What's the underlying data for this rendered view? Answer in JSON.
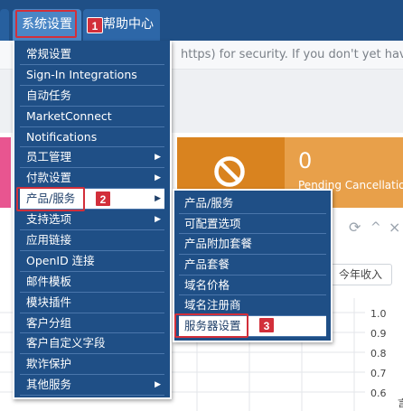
{
  "topnav": {
    "tabs": [
      {
        "label": "系统设置"
      },
      {
        "label": "帮助中心"
      }
    ]
  },
  "background": {
    "notice_text": "https) for security. If you don't yet have an",
    "pending_count": "0",
    "pending_label": "Pending Cancellation",
    "year_button": "今年收入",
    "y_ticks": [
      "1.0",
      "0.9",
      "0.8",
      "0.7",
      "0.6"
    ],
    "side_char": "言"
  },
  "menu": {
    "items": [
      {
        "label": "常规设置",
        "has_arrow": false
      },
      {
        "label": "Sign-In Integrations",
        "has_arrow": false
      },
      {
        "label": "自动任务",
        "has_arrow": false
      },
      {
        "label": "MarketConnect",
        "has_arrow": false
      },
      {
        "label": "Notifications",
        "has_arrow": false
      },
      {
        "label": "员工管理",
        "has_arrow": true
      },
      {
        "label": "付款设置",
        "has_arrow": true
      },
      {
        "label": "产品/服务",
        "has_arrow": true,
        "active": true
      },
      {
        "label": "支持选项",
        "has_arrow": true
      },
      {
        "label": "应用链接",
        "has_arrow": false
      },
      {
        "label": "OpenID 连接",
        "has_arrow": false
      },
      {
        "label": "邮件模板",
        "has_arrow": false
      },
      {
        "label": "模块插件",
        "has_arrow": false
      },
      {
        "label": "客户分组",
        "has_arrow": false
      },
      {
        "label": "客户自定义字段",
        "has_arrow": false
      },
      {
        "label": "欺诈保护",
        "has_arrow": false
      },
      {
        "label": "其他服务",
        "has_arrow": true
      }
    ]
  },
  "submenu": {
    "items": [
      {
        "label": "产品/服务"
      },
      {
        "label": "可配置选项"
      },
      {
        "label": "产品附加套餐"
      },
      {
        "label": "产品套餐"
      },
      {
        "label": "域名价格"
      },
      {
        "label": "域名注册商"
      },
      {
        "label": "服务器设置",
        "active": true
      }
    ]
  },
  "callouts": {
    "step1": "1",
    "step2": "2",
    "step3": "3"
  },
  "colors": {
    "nav_bg": "#1f4f86",
    "callout_red": "#d22f3a",
    "orange": "#e8a04a",
    "pink": "#e85590"
  },
  "icons": {
    "arrow": "▶",
    "refresh": "⟳",
    "collapse": "^",
    "close": "×"
  }
}
